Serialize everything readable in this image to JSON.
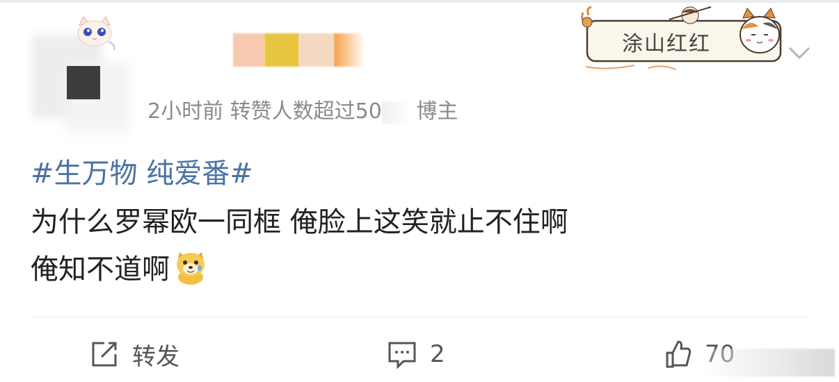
{
  "post": {
    "meta_visible": "2小时前 转赞人数超过50",
    "meta_tail": "博主",
    "hashtag": "#生万物 纯爱番#",
    "content_line1": "为什么罗幂欧一同框 俺脸上这笑就止不住啊",
    "content_line2": "俺知不道啊"
  },
  "badge": {
    "text": "涂山红红"
  },
  "actions": {
    "repost_label": "转发",
    "comment_count": "2",
    "like_count": "70"
  },
  "colors": {
    "hashtag": "#4a72a4",
    "text": "#222222",
    "meta": "#8a8a8a"
  },
  "icons": [
    "avatar-cat-icon",
    "chevron-down-icon",
    "repost-icon",
    "comment-icon",
    "like-icon",
    "doge-emoji-icon"
  ]
}
